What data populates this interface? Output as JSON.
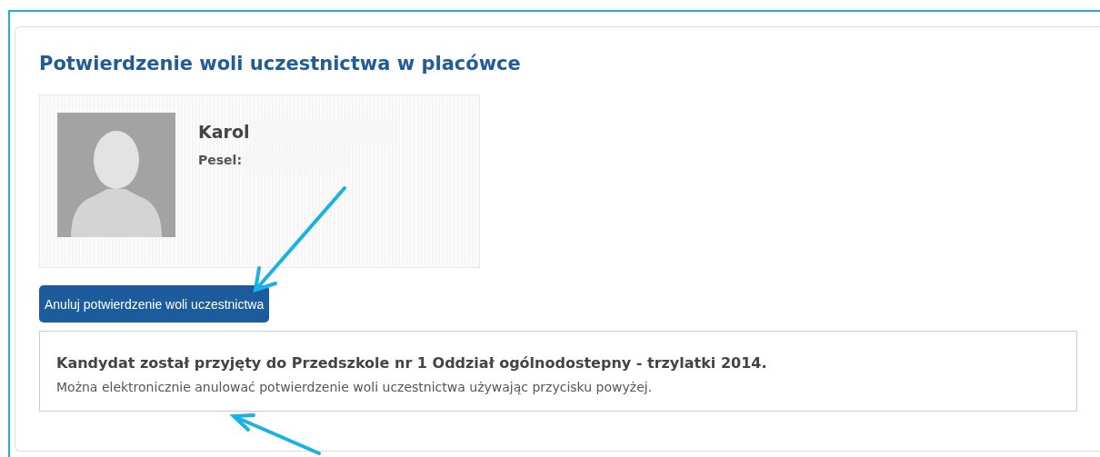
{
  "panel": {
    "title": "Potwierdzenie woli uczestnictwa w placówce"
  },
  "candidate": {
    "first_name": "Karol",
    "pesel_label": "Pesel:"
  },
  "button": {
    "label": "Anuluj potwierdzenie woli uczestnictwa"
  },
  "notice": {
    "heading": "Kandydat został przyjęty do Przedszkole nr 1 Oddział ogólnodostepny - trzylatki 2014.",
    "text": "Można elektronicznie anulować potwierdzenie woli uczestnictwa używając przycisku powyżej."
  }
}
